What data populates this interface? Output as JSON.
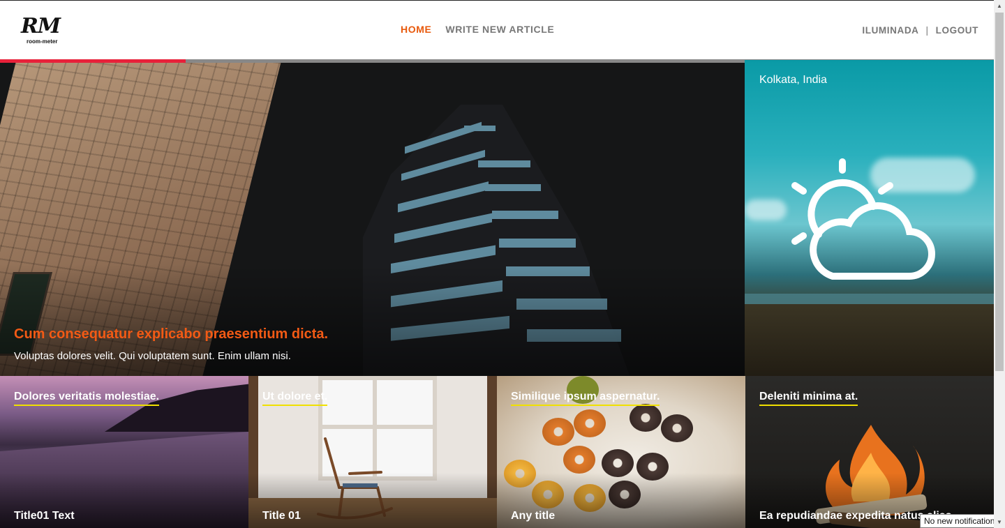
{
  "header": {
    "logo_mark": "RM",
    "logo_text": "room-meter",
    "nav": [
      {
        "label": "HOME",
        "active": true
      },
      {
        "label": "WRITE NEW ARTICLE",
        "active": false
      }
    ],
    "user": {
      "username": "ILUMINADA",
      "separator": "|",
      "logout": "LOGOUT"
    },
    "progress": 0.187
  },
  "hero": {
    "title": "Cum consequatur explicabo praesentium dicta.",
    "description": "Voluptas dolores velit. Qui voluptatem sunt. Enim ullam nisi."
  },
  "weather": {
    "location": "Kolkata, India",
    "condition_icon": "partly-cloudy-icon"
  },
  "cards": [
    {
      "top_title": "Dolores veritatis molestiae.",
      "bottom_title": "Title01 Text"
    },
    {
      "top_title": "Ut dolore et.",
      "bottom_title": "Title 01"
    },
    {
      "top_title": "Similique ipsum aspernatur.",
      "bottom_title": "Any title"
    },
    {
      "top_title": "Deleniti minima at.",
      "bottom_title": "Ea repudiandae expedita natus alias."
    }
  ],
  "notification": {
    "text": "No new notifications"
  },
  "colors": {
    "accent": "#e8590c",
    "hero_title": "#f25a15",
    "progress": "#e8213a",
    "underline": "#f0e000"
  }
}
